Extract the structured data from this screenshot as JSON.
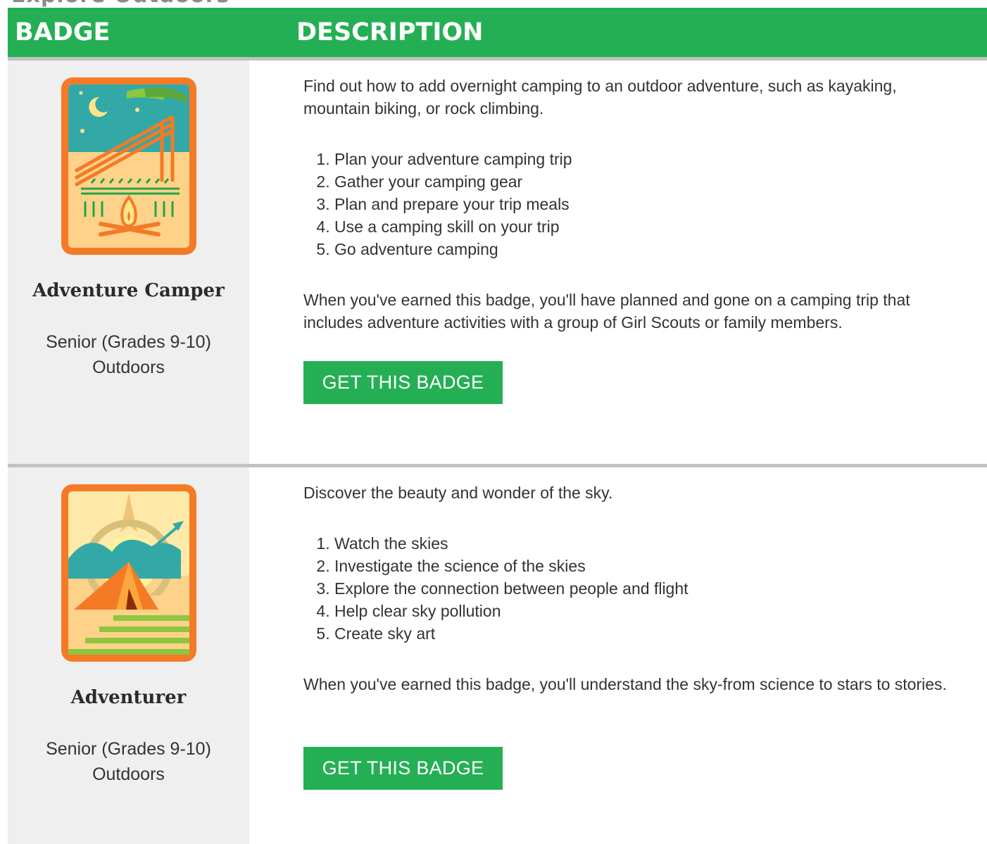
{
  "page": {
    "section_heading_partial": "Explore Outdoors"
  },
  "table": {
    "headers": {
      "badge": "BADGE",
      "description": "DESCRIPTION"
    },
    "rows": [
      {
        "badge_name": "Adventure Camper",
        "level": "Senior (Grades 9-10)",
        "category": "Outdoors",
        "badge_icon": "adventure-camper-badge-icon",
        "intro": "Find out how to add overnight camping to an outdoor adventure, such as kayaking, mountain biking, or rock climbing.",
        "steps": [
          "Plan your adventure camping trip",
          "Gather your camping gear",
          "Plan and prepare your trip meals",
          "Use a camping skill on your trip",
          "Go adventure camping"
        ],
        "outcome": "When you've earned this badge, you'll have planned and gone on a camping trip that includes adventure activities with a group of Girl Scouts or family members.",
        "button_label": "GET THIS BADGE"
      },
      {
        "badge_name": "Adventurer",
        "level": "Senior (Grades 9-10)",
        "category": "Outdoors",
        "badge_icon": "adventurer-badge-icon",
        "intro": "Discover the beauty and wonder of the sky.",
        "steps": [
          "Watch the skies",
          "Investigate the science of the skies",
          "Explore the connection between people and flight",
          "Help clear sky pollution",
          "Create sky art"
        ],
        "outcome": "When you've earned this badge, you'll understand the sky-from science to stars to stories.",
        "button_label": "GET THIS BADGE"
      }
    ]
  },
  "colors": {
    "brand_green": "#25af55",
    "badge_orange": "#f47a26",
    "badge_column_bg": "#efefef",
    "row_divider": "#c2c2c2"
  }
}
